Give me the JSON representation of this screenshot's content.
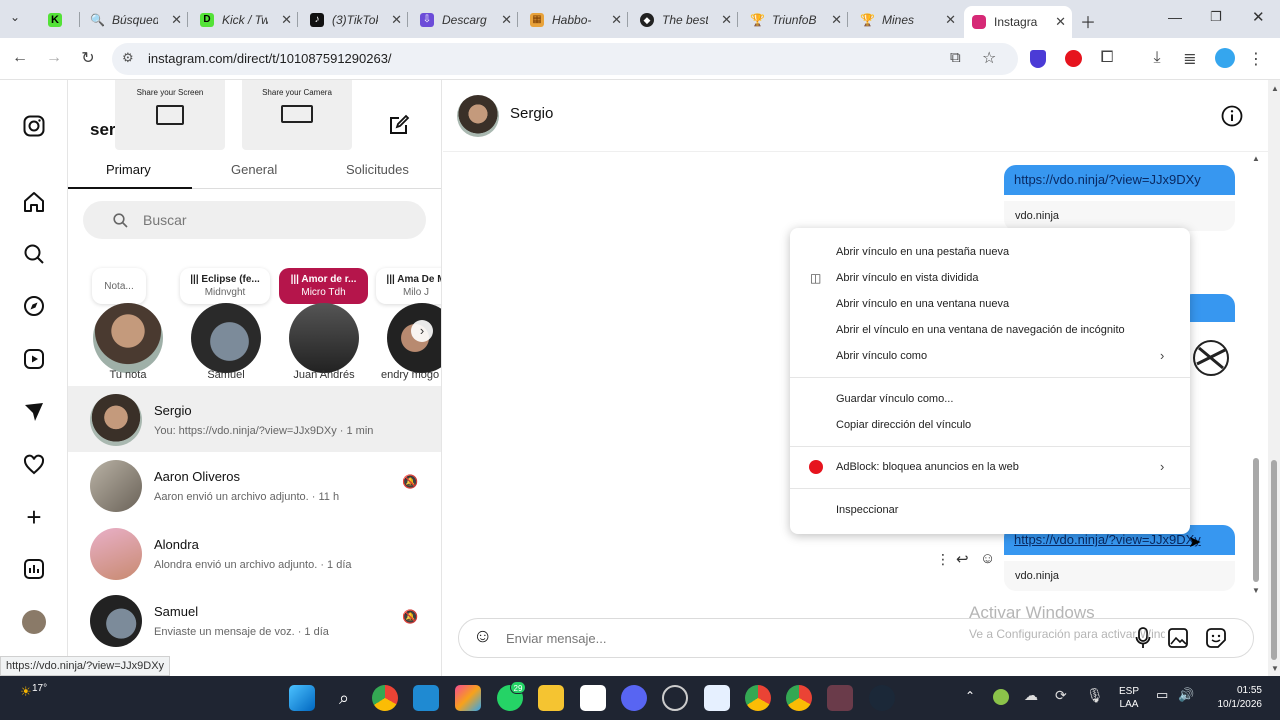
{
  "browser": {
    "tabs": [
      {
        "label": "",
        "color": "#53e237",
        "glyph": "K"
      },
      {
        "label": "Búsqued",
        "color": "#4285f4",
        "glyph": "🔍"
      },
      {
        "label": "Kick / Tw",
        "color": "#53e237",
        "glyph": "D"
      },
      {
        "label": "(3)TikTok",
        "color": "#111111",
        "glyph": "♪"
      },
      {
        "label": "Descarg",
        "color": "#6c4cd8",
        "glyph": "⇩"
      },
      {
        "label": "Habbo-",
        "color": "#e8a23a",
        "glyph": "▦"
      },
      {
        "label": "The best",
        "color": "#222222",
        "glyph": "◆"
      },
      {
        "label": "TriunfoB",
        "color": "#f0b400",
        "glyph": "🏆"
      },
      {
        "label": "Mines",
        "color": "#f0b400",
        "glyph": "🏆"
      },
      {
        "label": "Instagra",
        "color": "#d62976",
        "glyph": "◎"
      }
    ],
    "url": "instagram.com/direct/t/101087591290263/",
    "status_url": "https://vdo.ninja/?view=JJx9DXy"
  },
  "share": {
    "screen_label": "Share your Screen",
    "camera_label": "Share your Camera"
  },
  "inbox": {
    "username_partial": "ser",
    "tabs": [
      "Primary",
      "General",
      "Solicitudes"
    ],
    "search_placeholder": "Buscar",
    "notes": [
      {
        "line1": "Nota...",
        "line2": ""
      },
      {
        "line1": "||| Eclipse (fe...",
        "line2": "Midnvght"
      },
      {
        "line1": "||| Amor de r...",
        "line2": "Micro Tdh"
      },
      {
        "line1": "||| Ama De M",
        "line2": "Milo J"
      }
    ],
    "stories": [
      "Tu nota",
      "Samuel",
      "Juan Andrés",
      "endry mogo"
    ],
    "conversations": [
      {
        "name": "Sergio",
        "preview": "You: https://vdo.ninja/?view=JJx9DXy · 1 min"
      },
      {
        "name": "Aaron Oliveros",
        "preview": "Aaron envió un archivo adjunto. · 11 h"
      },
      {
        "name": "Alondra",
        "preview": "Alondra envió un archivo adjunto. · 1 día"
      },
      {
        "name": "Samuel",
        "preview": "Enviaste un mensaje de voz. · 1 día"
      }
    ]
  },
  "chat": {
    "contact_name": "Sergio",
    "messages": [
      {
        "link": "https://vdo.ninja/?view=JJx9DXy",
        "preview": "vdo.ninja"
      },
      {
        "link": "https://vdo.ninja/?view=JJx9DXy",
        "preview": "vdo.ninja"
      }
    ],
    "composer_placeholder": "Enviar mensaje..."
  },
  "context_menu": {
    "items": [
      "Abrir vínculo en una pestaña nueva",
      "Abrir vínculo en vista dividida",
      "Abrir vínculo en una ventana nueva",
      "Abrir el vínculo en una ventana de navegación de incógnito",
      "Abrir vínculo como",
      "Guardar vínculo como...",
      "Copiar dirección del vínculo",
      "AdBlock: bloquea anuncios en la web",
      "Inspeccionar"
    ]
  },
  "watermark": {
    "title": "Activar Windows",
    "subtitle": "Ve a Configuración para activar Windows."
  },
  "taskbar": {
    "weather": "17°",
    "lang1": "ESP",
    "lang2": "LAA",
    "time": "01:55",
    "date": "10/1/2026",
    "whatsapp_badge": "29"
  },
  "colors": {
    "accent_blue": "#3797f0",
    "instagram_pink": "#d62976",
    "note_highlight": "#b5154b"
  }
}
